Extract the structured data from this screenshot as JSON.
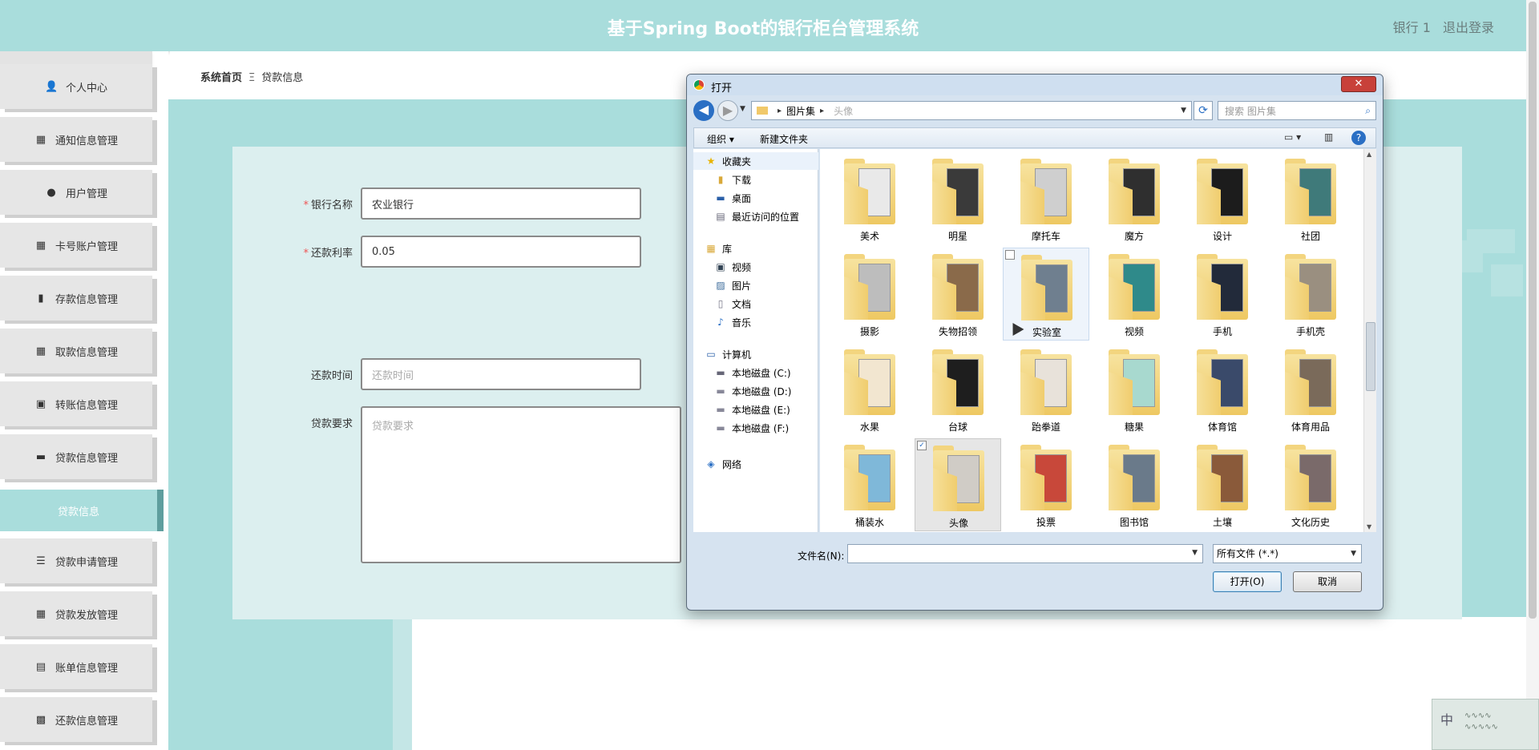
{
  "header": {
    "title": "基于Spring Boot的银行柜台管理系统",
    "username": "银行 1",
    "logout": "退出登录"
  },
  "sidebar": {
    "items": [
      {
        "label": "个人中心",
        "icon": "person-icon"
      },
      {
        "label": "通知信息管理",
        "icon": "grid-icon"
      },
      {
        "label": "用户管理",
        "icon": "pin-icon"
      },
      {
        "label": "卡号账户管理",
        "icon": "grid-icon"
      },
      {
        "label": "存款信息管理",
        "icon": "bar-chart-icon"
      },
      {
        "label": "取款信息管理",
        "icon": "grid-icon"
      },
      {
        "label": "转账信息管理",
        "icon": "clipboard-x-icon"
      },
      {
        "label": "贷款信息管理",
        "icon": "briefcase-icon"
      },
      {
        "label": "贷款信息",
        "icon": ""
      },
      {
        "label": "贷款申请管理",
        "icon": "sliders-icon"
      },
      {
        "label": "贷款发放管理",
        "icon": "grid-icon"
      },
      {
        "label": "账单信息管理",
        "icon": "clipboard-icon"
      },
      {
        "label": "还款信息管理",
        "icon": "apps-icon"
      }
    ]
  },
  "breadcrumb": {
    "home": "系统首页",
    "separator": "Ξ",
    "current": "贷款信息"
  },
  "form": {
    "bank_name_label": "银行名称",
    "bank_name_value": "农业银行",
    "rate_label": "还款利率",
    "rate_value": "0.05",
    "repay_time_label": "还款时间",
    "repay_time_placeholder": "还款时间",
    "requirement_label": "贷款要求",
    "requirement_placeholder": "贷款要求",
    "required_mark": "*"
  },
  "dialog": {
    "title": "打开",
    "close": "✕",
    "address": {
      "root": "图片集",
      "current": "头像"
    },
    "search_placeholder": "搜索 图片集",
    "toolbar": {
      "organize": "组织 ▾",
      "new_folder": "新建文件夹"
    },
    "nav": {
      "favorites": "收藏夹",
      "downloads": "下载",
      "desktop": "桌面",
      "recent": "最近访问的位置",
      "library": "库",
      "videos": "视频",
      "pictures": "图片",
      "documents": "文档",
      "music": "音乐",
      "computer": "计算机",
      "disk_c": "本地磁盘 (C:)",
      "disk_d": "本地磁盘 (D:)",
      "disk_e": "本地磁盘 (E:)",
      "disk_f": "本地磁盘 (F:)",
      "network": "网络"
    },
    "folders": [
      "美术",
      "明星",
      "摩托车",
      "魔方",
      "设计",
      "社团",
      "摄影",
      "失物招领",
      "实验室",
      "视频",
      "手机",
      "手机壳",
      "水果",
      "台球",
      "跆拳道",
      "糖果",
      "体育馆",
      "体育用品",
      "桶装水",
      "头像",
      "投票",
      "图书馆",
      "土壤",
      "文化历史"
    ],
    "filename_label": "文件名(N):",
    "filename_value": "",
    "filetype": "所有文件 (*.*)",
    "open_button": "打开(O)",
    "cancel_button": "取消"
  },
  "ime": {
    "lang": "中"
  },
  "colors": {
    "header": "#a9dddc",
    "accent": "#5e9e9e",
    "sidebar_item": "#e6e6e6"
  }
}
